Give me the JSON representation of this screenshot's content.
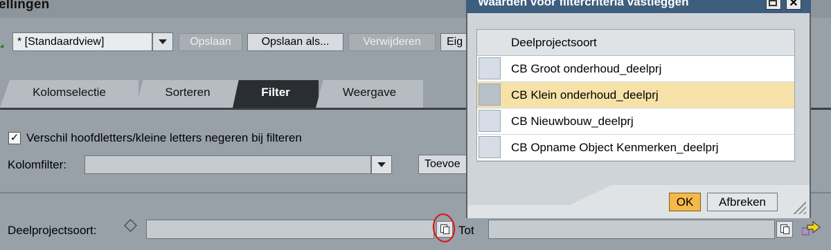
{
  "page": {
    "title": "ellingen"
  },
  "toolbar": {
    "view_value": "* [Standaardview]",
    "save_label": "Opslaan",
    "save_as_label": "Opslaan als...",
    "delete_label": "Verwijderen",
    "own_label": "Eig"
  },
  "tabs": [
    {
      "label": "Kolomselectie"
    },
    {
      "label": "Sorteren"
    },
    {
      "label": "Filter"
    },
    {
      "label": "Weergave"
    }
  ],
  "filter": {
    "case_label": "Verschil hoofdletters/kleine letters negeren bij filteren",
    "case_checked": true,
    "column_filter_label": "Kolomfilter:",
    "column_filter_value": "",
    "add_label": "Toevoe",
    "field_label": "Deelprojectsoort:",
    "from_value": "",
    "to_label": "Tot",
    "to_value": ""
  },
  "dialog": {
    "title": "Waarden voor filtercriteria vastleggen",
    "column_header": "Deelprojectsoort",
    "rows": [
      {
        "label": "CB Groot onderhoud_deelprj",
        "selected": false
      },
      {
        "label": "CB Klein onderhoud_deelprj",
        "selected": true
      },
      {
        "label": "CB Nieuwbouw_deelprj",
        "selected": false
      },
      {
        "label": "CB Opname Object Kenmerken_deelprj",
        "selected": false
      }
    ],
    "ok_label": "OK",
    "cancel_label": "Afbreken"
  },
  "colors": {
    "background": "#98a0a8",
    "active_tab": "#2a2e33",
    "selected_row": "#f6e2a8",
    "ok_button": "#f5b84a",
    "annotation_circle": "#e01010"
  }
}
